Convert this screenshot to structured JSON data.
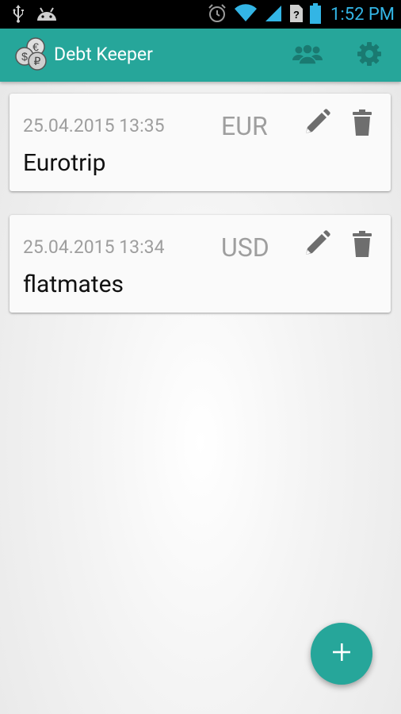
{
  "status_bar": {
    "time": "1:52 PM",
    "icons": [
      "usb-icon",
      "android-icon",
      "alarm-icon",
      "wifi-icon",
      "signal-icon",
      "sim-unknown-icon",
      "battery-icon"
    ]
  },
  "app_bar": {
    "title": "Debt Keeper",
    "logo_icon": "coins-logo-icon",
    "actions": [
      "group-icon",
      "settings-icon"
    ],
    "color": "#26a69a"
  },
  "debt_lists": [
    {
      "date": "25.04.2015 13:35",
      "currency": "EUR",
      "name": "Eurotrip"
    },
    {
      "date": "25.04.2015 13:34",
      "currency": "USD",
      "name": "flatmates"
    }
  ],
  "fab": {
    "icon": "plus-icon",
    "color": "#26a69a"
  },
  "colors": {
    "accent": "#26a69a",
    "status_text": "#33b5e5",
    "muted_text": "#9e9e9e",
    "icon_gray": "#6e6e6e"
  }
}
